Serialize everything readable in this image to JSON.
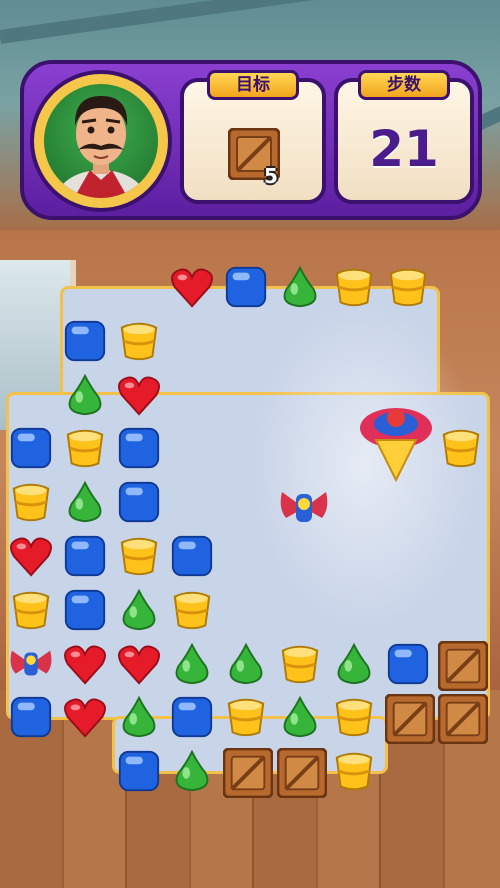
{
  "header": {
    "goal_label": "目标",
    "goal_count": "5",
    "goal_item_icon": "wooden-crate-icon",
    "moves_label": "步数",
    "moves_count": "21",
    "character": "mustached-host-avatar"
  },
  "colors": {
    "frame_purple": "#6a2bb8",
    "tab_gold": "#f6c33a",
    "board_tile": "#c8d4e8",
    "board_border": "#f2c14a"
  },
  "board": {
    "columns": 9,
    "rows": 9,
    "grid": [
      [
        "",
        "",
        "",
        "heart",
        "blue",
        "pear",
        "pot",
        "pot",
        ""
      ],
      [
        "",
        "blue",
        "pot",
        "",
        "",
        "",
        "",
        "",
        ""
      ],
      [
        "",
        "pear",
        "heart",
        "",
        "",
        "",
        "",
        "",
        ""
      ],
      [
        "blue",
        "pot",
        "blue",
        "",
        "",
        "",
        "",
        "",
        "pot"
      ],
      [
        "pot",
        "pear",
        "blue",
        "",
        "",
        "",
        "",
        "",
        ""
      ],
      [
        "heart",
        "blue",
        "pot",
        "blue",
        "",
        "",
        "",
        "",
        ""
      ],
      [
        "pot",
        "blue",
        "pear",
        "pot",
        "",
        "",
        "",
        "",
        ""
      ],
      [
        "propeller",
        "heart",
        "heart",
        "pear",
        "pear",
        "pot",
        "pear",
        "blue",
        "crate"
      ],
      [
        "blue",
        "heart",
        "pear",
        "blue",
        "pot",
        "pear",
        "pot",
        "crate",
        "crate"
      ],
      [
        "",
        "",
        "blue",
        "pear",
        "crate",
        "crate",
        "pot",
        "",
        ""
      ]
    ],
    "effects": [
      "spinning-top",
      "propeller"
    ]
  }
}
